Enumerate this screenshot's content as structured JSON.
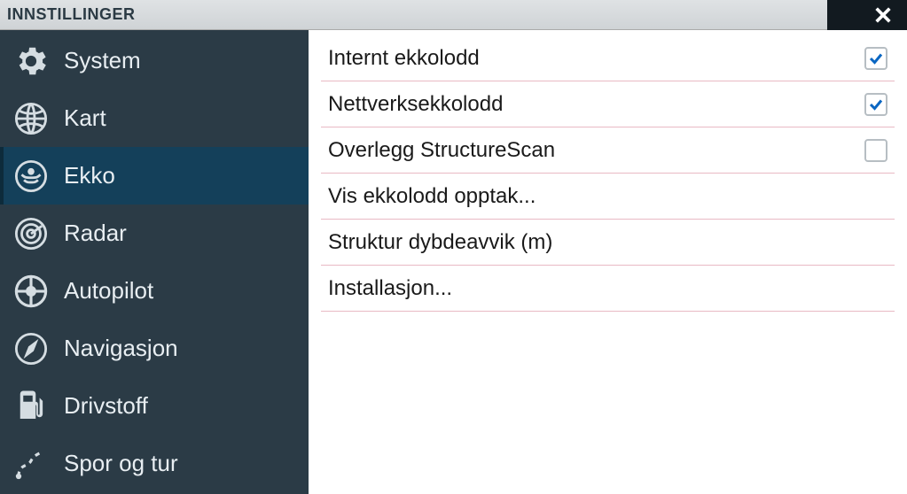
{
  "header": {
    "title": "INNSTILLINGER"
  },
  "sidebar": {
    "items": [
      {
        "label": "System",
        "icon": "gear-icon"
      },
      {
        "label": "Kart",
        "icon": "globe-icon"
      },
      {
        "label": "Ekko",
        "icon": "sonar-icon",
        "selected": true
      },
      {
        "label": "Radar",
        "icon": "radar-icon"
      },
      {
        "label": "Autopilot",
        "icon": "wheel-icon"
      },
      {
        "label": "Navigasjon",
        "icon": "compass-icon"
      },
      {
        "label": "Drivstoff",
        "icon": "fuel-icon"
      },
      {
        "label": "Spor og tur",
        "icon": "track-icon"
      }
    ]
  },
  "content": {
    "rows": [
      {
        "label": "Internt ekkolodd",
        "type": "check",
        "checked": true
      },
      {
        "label": "Nettverksekkolodd",
        "type": "check",
        "checked": true
      },
      {
        "label": "Overlegg StructureScan",
        "type": "check",
        "checked": false
      },
      {
        "label": "Vis ekkolodd opptak...",
        "type": "nav"
      },
      {
        "label": "Struktur dybdeavvik (m)",
        "type": "nav"
      },
      {
        "label": "Installasjon...",
        "type": "nav"
      }
    ]
  }
}
